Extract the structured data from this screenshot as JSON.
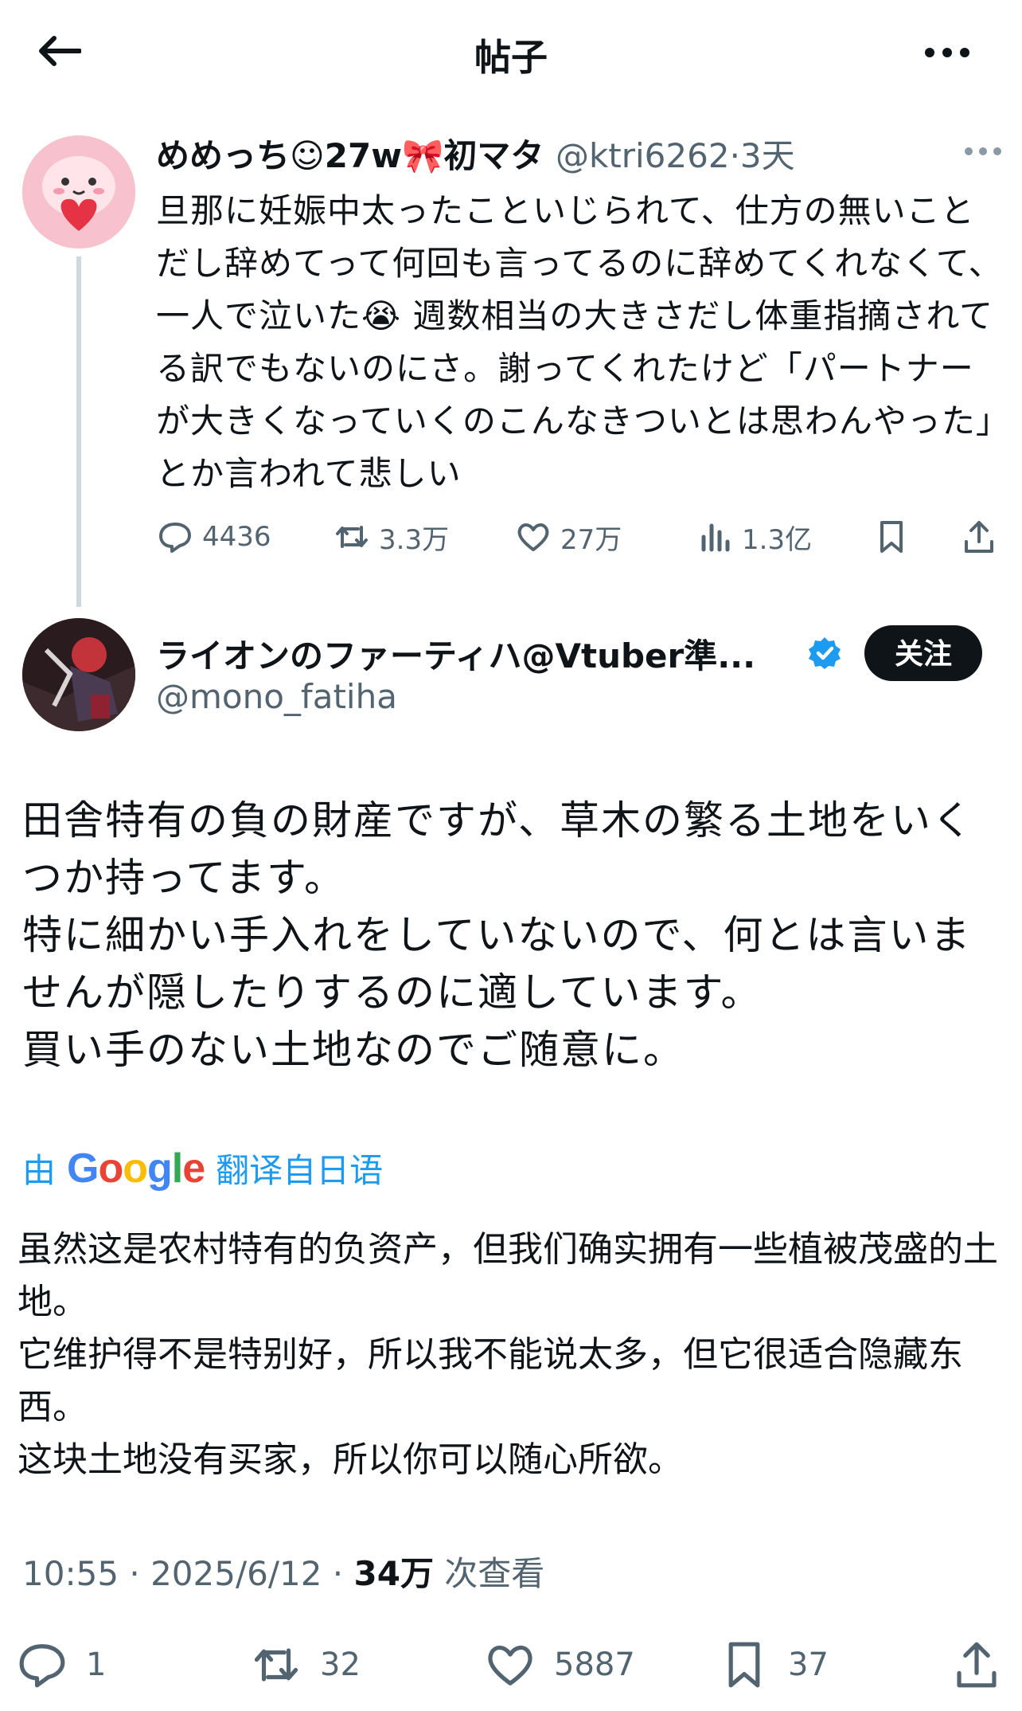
{
  "header": {
    "title": "帖子",
    "back_icon": "arrow-left-icon",
    "more_icon": "more-icon"
  },
  "parent_tweet": {
    "display_name": "めめっち☺27w🎀初マタ",
    "handle": "@ktri6262",
    "time": "·3天",
    "text": "旦那に妊娠中太ったこといじられて、仕方の無いことだし辞めてって何回も言ってるのに辞めてくれなくて、一人で泣いた😭 週数相当の大きさだし体重指摘されてる訳でもないのにさ。謝ってくれたけど「パートナーが大きくなっていくのこんなきついとは思わんやった」とか言われて悲しい",
    "stats": {
      "replies": "4436",
      "retweets": "3.3万",
      "likes": "27万",
      "views": "1.3亿"
    }
  },
  "reply_tweet": {
    "display_name": "ライオンのファーティハ@Vtuber準...",
    "handle": "@mono_fatiha",
    "follow_label": "关注",
    "text": "田舎特有の負の財産ですが、草木の繁る土地をいくつか持ってます。\n特に細かい手入れをしていないので、何とは言いませんが隠したりするのに適しています。\n買い手のない土地なのでご随意に。",
    "translate_prefix": "由",
    "translate_brand": "Google",
    "translate_suffix": "翻译自日语",
    "translated_text": "虽然这是农村特有的负资产，但我们确实拥有一些植被茂盛的土地。\n它维护得不是特别好，所以我不能说太多，但它很适合隐藏东西。\n这块土地没有买家，所以你可以随心所欲。",
    "meta": {
      "time": "10:55 · 2025/6/12 · ",
      "views": "34万",
      "views_label": " 次查看"
    },
    "stats": {
      "replies": "1",
      "retweets": "32",
      "likes": "5887",
      "bookmarks": "37"
    }
  },
  "colors": {
    "accent": "#1d9bf0",
    "text": "#0f1419",
    "muted": "#536471",
    "divider": "#cfd9de"
  }
}
